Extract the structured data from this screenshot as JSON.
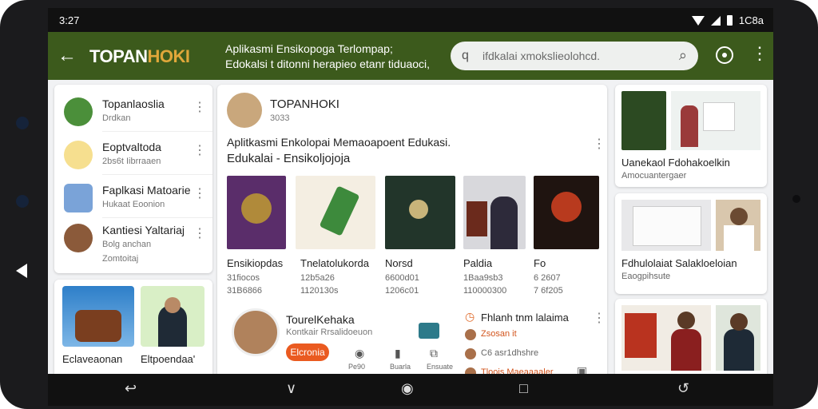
{
  "status": {
    "time": "3:27",
    "battery": "1C8a"
  },
  "appbar": {
    "brand_main": "TOPAN",
    "brand_accent": "HOKI",
    "tagline_line1": "Aplikasmi Ensikopoga Terlompap;",
    "tagline_line2": "Edokalsi t ditonni herapieo etanr tiduaoci,",
    "search_placeholder": "ifdkalai xmokslieolohcd."
  },
  "left_list": [
    {
      "title": "Topanlaoslia",
      "sub": "Drdkan",
      "sub2": ""
    },
    {
      "title": "Eoptvaltoda",
      "sub": "2bs6t  Iibrraaen",
      "sub2": ""
    },
    {
      "title": "Faplkasi Matoarie",
      "sub": "Hukaat  Eoonion",
      "sub2": ""
    },
    {
      "title": "Kantiesi Yaltariaj",
      "sub": "Bolg anchan",
      "sub2": "Zomtoitaj"
    }
  ],
  "left_bottom": [
    {
      "caption": "Eclaveaonan"
    },
    {
      "caption": "Eltpoendaa'"
    }
  ],
  "main": {
    "profile_name": "TOPANHOKI",
    "profile_stat": "3033",
    "headline": "Aplitkasmi Enkolopai Memaoapoent Edukasi.",
    "subheadline": "Edukalai - Ensikoljojoja",
    "books": [
      {
        "title": "Ensikiopdas",
        "line1": "31fiocos",
        "line2": "31B6866"
      },
      {
        "title": "Tnelatolukorda",
        "line1": "12b5a26",
        "line2": "1120130s"
      },
      {
        "title": "Norsd",
        "line1": "6600d01",
        "line2": "1206c01"
      },
      {
        "title": "Paldia",
        "line1": "1Baa9sb3",
        "line2": "110000300"
      },
      {
        "title": "Fo",
        "line1": "6 2607",
        "line2": "7 6f205"
      }
    ],
    "author_name": "TourelKehaka",
    "author_sub": "Kontkair Rrsalidoeuon",
    "author_button": "Elcronia",
    "action1": "Pe90",
    "action2": "Buarla",
    "action3": "Ensuate",
    "side_title": "Fhlanh tnm lalaima",
    "side_item1": "Zsosan it",
    "side_item2": "C6 asr1dhshre",
    "side_item3": "Tloois Maeaaaaler"
  },
  "right": [
    {
      "title": "Uanekaol Fdohakoelkin",
      "sub": "Amocuantergaer"
    },
    {
      "title": "Fdhulolaiat Salakloeloian",
      "sub": "Eaogpihsute"
    }
  ],
  "colors": {
    "appbar": "#3c5a1c",
    "accent": "#ea5a20",
    "brand_accent": "#e0a73a"
  }
}
